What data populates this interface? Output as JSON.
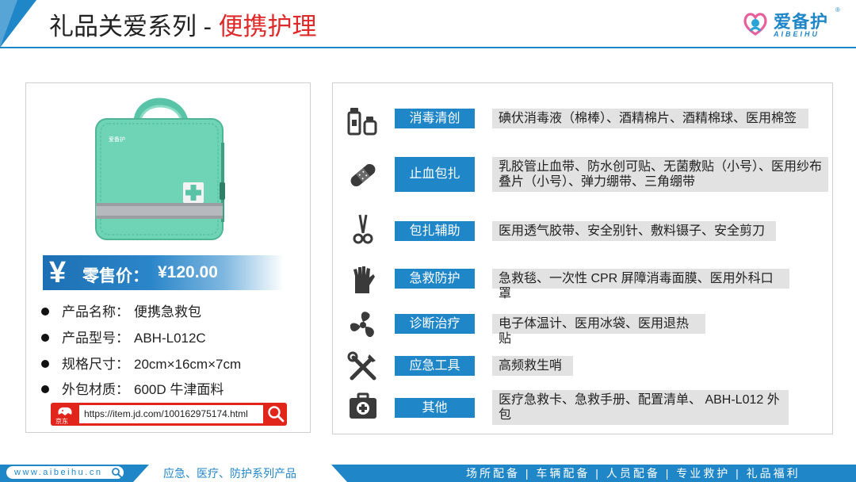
{
  "header": {
    "title_main": "礼品关爱系列 - ",
    "title_highlight": "便携护理",
    "logo_cn": "爱备护",
    "logo_en": "AIBEIHU",
    "logo_reg": "®"
  },
  "product": {
    "bag_logo_text": "爱备护",
    "price_symbol": "¥",
    "price_label": "零售价：",
    "price_value": "¥120.00",
    "specs": [
      {
        "label": "产品名称：",
        "value": "便携急救包"
      },
      {
        "label": "产品型号：",
        "value": "ABH-L012C"
      },
      {
        "label": "规格尺寸：",
        "value": "20cm×16cm×7cm"
      },
      {
        "label": "外包材质：",
        "value": "600D 牛津面料"
      }
    ],
    "jd_label": "京东",
    "jd_url": "https://item.jd.com/100162975174.html"
  },
  "categories": [
    {
      "label": "消毒清创",
      "icon": "bottles-icon",
      "items": "碘伏消毒液（棉棒）、酒精棉片、酒精棉球、医用棉签"
    },
    {
      "label": "止血包扎",
      "icon": "bandage-icon",
      "items": "乳胶管止血带、防水创可贴、无菌敷贴（小号）、医用纱布叠片（小号）、弹力绷带、三角绷带"
    },
    {
      "label": "包扎辅助",
      "icon": "scissors-icon",
      "items": "医用透气胶带、安全别针、敷料镊子、安全剪刀"
    },
    {
      "label": "急救防护",
      "icon": "glove-icon",
      "items": "急救毯、一次性 CPR 屏障消毒面膜、医用外科口罩"
    },
    {
      "label": "诊断治疗",
      "icon": "fan-icon",
      "items": "电子体温计、医用冰袋、医用退热贴"
    },
    {
      "label": "应急工具",
      "icon": "tools-icon",
      "items": "高频救生哨"
    },
    {
      "label": "其他",
      "icon": "medkit-icon",
      "items": "医疗急救卡、急救手册、配置清单、 ABH-L012 外包"
    }
  ],
  "footer": {
    "url": "www.aibeihu.cn",
    "slogan": "应急、医疗、防护系列产品",
    "nav": "场所配备 | 车辆配备 | 人员配备 | 专业救护 | 礼品福利"
  },
  "colors": {
    "brand_blue": "#1f86c8",
    "accent_red": "#e02a2a",
    "bag_teal": "#6fd3b6",
    "jd_red": "#e1251b"
  }
}
